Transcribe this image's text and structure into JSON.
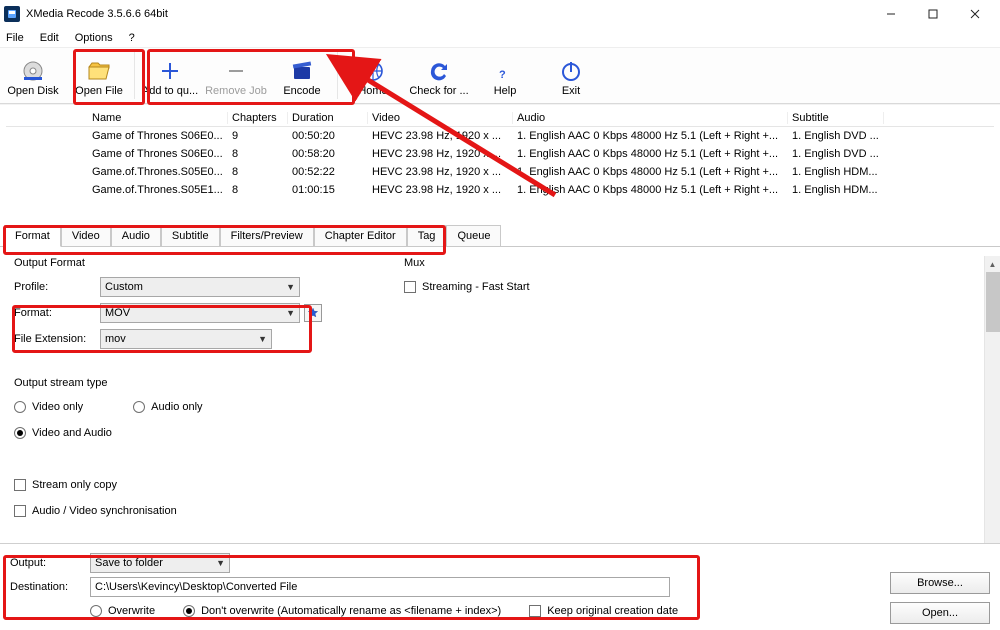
{
  "window": {
    "title": "XMedia Recode 3.5.6.6 64bit"
  },
  "menu": [
    "File",
    "Edit",
    "Options",
    "?"
  ],
  "toolbar": [
    {
      "id": "open-disk",
      "label": "Open Disk"
    },
    {
      "id": "open-file",
      "label": "Open File"
    },
    {
      "id": "add-queue",
      "label": "Add to qu..."
    },
    {
      "id": "remove-job",
      "label": "Remove Job",
      "disabled": true
    },
    {
      "id": "encode",
      "label": "Encode"
    },
    {
      "id": "home",
      "label": "Home"
    },
    {
      "id": "check-update",
      "label": "Check for ..."
    },
    {
      "id": "help",
      "label": "Help"
    },
    {
      "id": "exit",
      "label": "Exit"
    }
  ],
  "filetable": {
    "headers": [
      "",
      "Name",
      "Chapters",
      "Duration",
      "Video",
      "Audio",
      "Subtitle"
    ],
    "rows": [
      {
        "name": "Game of Thrones S06E0...",
        "chapters": "9",
        "duration": "00:50:20",
        "video": "HEVC 23.98 Hz, 1920 x ...",
        "audio": "1. English AAC  0 Kbps 48000 Hz 5.1 (Left + Right +...",
        "subtitle": "1. English DVD ..."
      },
      {
        "name": "Game of Thrones S06E0...",
        "chapters": "8",
        "duration": "00:58:20",
        "video": "HEVC 23.98 Hz, 1920 x ...",
        "audio": "1. English AAC  0 Kbps 48000 Hz 5.1 (Left + Right +...",
        "subtitle": "1. English DVD ..."
      },
      {
        "name": "Game.of.Thrones.S05E0...",
        "chapters": "8",
        "duration": "00:52:22",
        "video": "HEVC 23.98 Hz, 1920 x ...",
        "audio": "1. English AAC  0 Kbps 48000 Hz 5.1 (Left + Right +...",
        "subtitle": "1. English HDM..."
      },
      {
        "name": "Game.of.Thrones.S05E1...",
        "chapters": "8",
        "duration": "01:00:15",
        "video": "HEVC 23.98 Hz, 1920 x ...",
        "audio": "1. English AAC  0 Kbps 48000 Hz 5.1 (Left + Right +...",
        "subtitle": "1. English HDM..."
      }
    ]
  },
  "tabs": [
    "Format",
    "Video",
    "Audio",
    "Subtitle",
    "Filters/Preview",
    "Chapter Editor",
    "Tag",
    "Queue"
  ],
  "format_panel": {
    "output_format_title": "Output Format",
    "mux_title": "Mux",
    "profile_label": "Profile:",
    "profile_value": "Custom",
    "format_label": "Format:",
    "format_value": "MOV",
    "fileext_label": "File Extension:",
    "fileext_value": "mov",
    "streaming_label": "Streaming - Fast Start",
    "output_stream_title": "Output stream type",
    "video_only": "Video only",
    "audio_only": "Audio only",
    "video_and_audio": "Video and Audio",
    "stream_only_copy": "Stream only copy",
    "av_sync": "Audio / Video synchronisation"
  },
  "bottom": {
    "output_label": "Output:",
    "output_value": "Save to folder",
    "destination_label": "Destination:",
    "destination_value": "C:\\Users\\Kevincy\\Desktop\\Converted File",
    "overwrite": "Overwrite",
    "dont_overwrite": "Don't overwrite (Automatically rename as <filename + index>)",
    "keep_date": "Keep original creation date",
    "browse": "Browse...",
    "open": "Open..."
  }
}
